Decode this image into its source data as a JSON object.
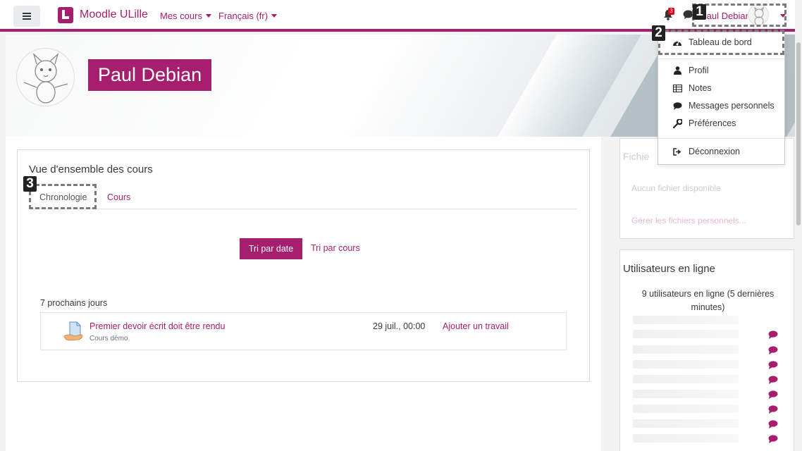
{
  "navbar": {
    "brand": "Moodle ULille",
    "my_courses": "Mes cours",
    "language": "Français (fr)",
    "notif_count": "3",
    "user_name": "Paul Debian"
  },
  "header": {
    "name": "Paul Debian"
  },
  "user_menu": {
    "items": [
      {
        "label": "Tableau de bord",
        "icon": "dashboard-icon"
      },
      {
        "label": "Profil",
        "icon": "user-icon"
      },
      {
        "label": "Notes",
        "icon": "grades-table-icon"
      },
      {
        "label": "Messages personnels",
        "icon": "chat-icon"
      },
      {
        "label": "Préférences",
        "icon": "wrench-icon"
      },
      {
        "label": "Déconnexion",
        "icon": "logout-icon"
      }
    ]
  },
  "course_overview": {
    "title": "Vue d'ensemble des cours",
    "tabs": [
      "Chronologie",
      "Cours"
    ],
    "sort_by_date": "Tri par date",
    "sort_by_course": "Tri par cours",
    "period_label": "7 prochains jours",
    "events": [
      {
        "title": "Premier devoir écrit doit être rendu",
        "course": "Cours démo",
        "date": "29 juil., 00:00",
        "action": "Ajouter un travail"
      }
    ]
  },
  "files_block": {
    "title": "Fichie",
    "none": "Aucun fichier disponible",
    "manage": "Gérer les fichiers personnels..."
  },
  "online_users": {
    "title": "Utilisateurs en ligne",
    "count": "9 utilisateurs en ligne (5 dernières minutes)"
  },
  "annotations": [
    "1",
    "2",
    "3"
  ],
  "colors": {
    "accent": "#a61e6e",
    "badge": "#e2001a"
  }
}
